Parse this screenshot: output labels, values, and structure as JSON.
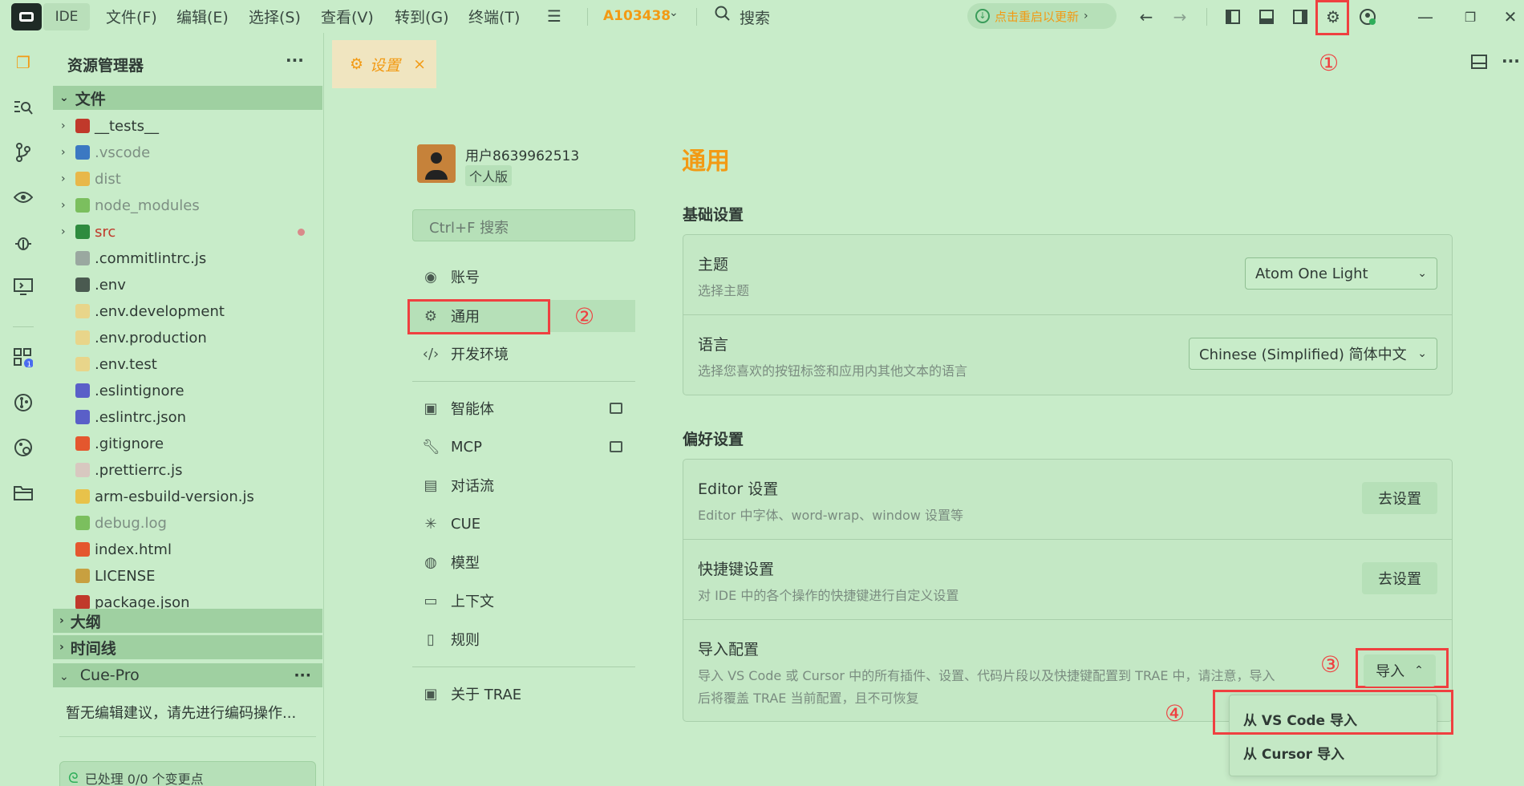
{
  "titlebar": {
    "app_label": "IDE",
    "menus": [
      "文件(F)",
      "编辑(E)",
      "选择(S)",
      "查看(V)",
      "转到(G)",
      "终端(T)"
    ],
    "project": "A103438",
    "search": "搜索",
    "update_text": "点击重启以更新",
    "annotation": "①"
  },
  "explorer": {
    "title": "资源管理器",
    "more": "···",
    "section_files": "文件",
    "files": [
      {
        "name": "__tests__",
        "folder": true,
        "icon_color": "#c0392b"
      },
      {
        "name": ".vscode",
        "folder": true,
        "icon_color": "#3b78c2",
        "dim": true
      },
      {
        "name": "dist",
        "folder": true,
        "icon_color": "#e8b84a",
        "dim": true
      },
      {
        "name": "node_modules",
        "folder": true,
        "icon_color": "#7bbf5e",
        "dim": true
      },
      {
        "name": "src",
        "folder": true,
        "icon_color": "#2e8b3e",
        "red": true
      },
      {
        "name": ".commitlintrc.js",
        "icon_color": "#9aa8a0"
      },
      {
        "name": ".env",
        "icon_color": "#4a5a50"
      },
      {
        "name": ".env.development",
        "icon_color": "#e8d58a"
      },
      {
        "name": ".env.production",
        "icon_color": "#e8d58a"
      },
      {
        "name": ".env.test",
        "icon_color": "#e8d58a"
      },
      {
        "name": ".eslintignore",
        "icon_color": "#5a5fc8"
      },
      {
        "name": ".eslintrc.json",
        "icon_color": "#5a5fc8"
      },
      {
        "name": ".gitignore",
        "icon_color": "#e4572e"
      },
      {
        "name": ".prettierrc.js",
        "icon_color": "#d8c8c0"
      },
      {
        "name": "arm-esbuild-version.js",
        "icon_color": "#e8c24a"
      },
      {
        "name": "debug.log",
        "icon_color": "#7bbf5e",
        "dim": true
      },
      {
        "name": "index.html",
        "icon_color": "#e4572e"
      },
      {
        "name": "LICENSE",
        "icon_color": "#c8a040"
      },
      {
        "name": "package.json",
        "icon_color": "#c0392b"
      }
    ],
    "section_outline": "大纲",
    "section_timeline": "时间线",
    "section_cue": "Cue-Pro",
    "cue_message": "暂无编辑建议，请先进行编码操作...",
    "cue_status": "已处理 0/0 个变更点"
  },
  "tab": {
    "label": "设置",
    "close": "×"
  },
  "settings_nav": {
    "username": "用户8639962513",
    "plan": "个人版",
    "search_placeholder": "Ctrl+F 搜索",
    "items": [
      {
        "label": "账号",
        "icon": "user-circle-icon"
      },
      {
        "label": "通用",
        "icon": "gear-icon"
      },
      {
        "label": "开发环境",
        "icon": "code-icon"
      },
      {
        "label": "智能体",
        "icon": "bot-icon"
      },
      {
        "label": "MCP",
        "icon": "wrench-icon"
      },
      {
        "label": "对话流",
        "icon": "terminal-icon"
      },
      {
        "label": "CUE",
        "icon": "sparkle-icon"
      },
      {
        "label": "模型",
        "icon": "globe-icon"
      },
      {
        "label": "上下文",
        "icon": "folder-icon"
      },
      {
        "label": "规则",
        "icon": "book-icon"
      },
      {
        "label": "关于 TRAE",
        "icon": "trae-icon"
      }
    ],
    "annotation": "②"
  },
  "settings_main": {
    "title": "通用",
    "basic_heading": "基础设置",
    "theme_title": "主题",
    "theme_desc": "选择主题",
    "theme_value": "Atom One Light",
    "lang_title": "语言",
    "lang_desc": "选择您喜欢的按钮标签和应用内其他文本的语言",
    "lang_value": "Chinese (Simplified) 简体中文",
    "pref_heading": "偏好设置",
    "editor_title": "Editor 设置",
    "editor_desc": "Editor 中字体、word-wrap、window 设置等",
    "editor_btn": "去设置",
    "keys_title": "快捷键设置",
    "keys_desc": "对 IDE 中的各个操作的快捷键进行自定义设置",
    "keys_btn": "去设置",
    "import_title": "导入配置",
    "import_desc_1": "导入 VS Code 或 Cursor 中的所有插件、设置、代码片段以及快捷键配置到 TRAE 中，请注意，导入",
    "import_desc_2": "后将覆盖 TRAE 当前配置，且不可恢复",
    "import_btn": "导入",
    "import_options": [
      "从 VS Code 导入",
      "从 Cursor 导入"
    ],
    "annotation_3": "③",
    "annotation_4": "④"
  }
}
